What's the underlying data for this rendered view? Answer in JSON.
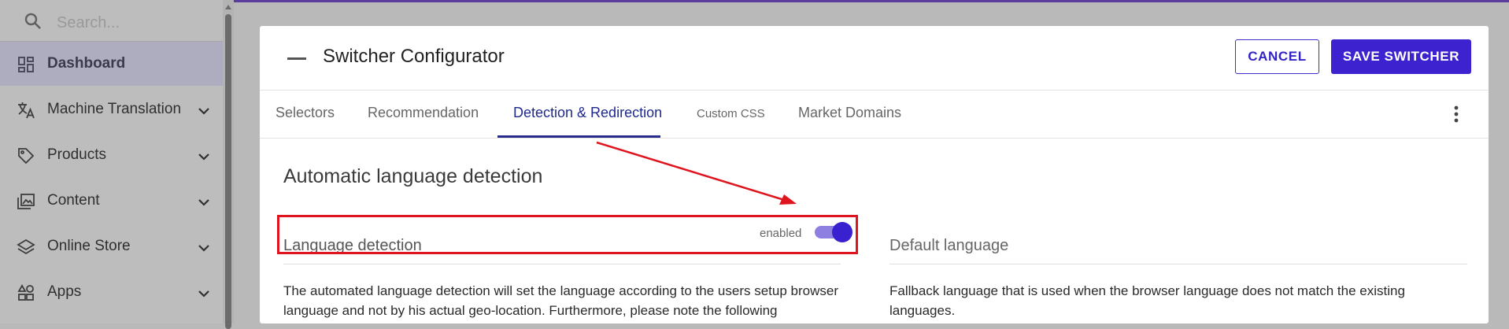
{
  "search": {
    "placeholder": "Search..."
  },
  "sidebar": {
    "items": [
      {
        "label": "Dashboard",
        "icon": "dashboard-icon",
        "active": true
      },
      {
        "label": "Machine Translation",
        "icon": "translate-icon",
        "expandable": true
      },
      {
        "label": "Products",
        "icon": "tag-icon",
        "expandable": true
      },
      {
        "label": "Content",
        "icon": "image-gallery-icon",
        "expandable": true
      },
      {
        "label": "Online Store",
        "icon": "layers-icon",
        "expandable": true
      },
      {
        "label": "Apps",
        "icon": "apps-icon",
        "expandable": true
      }
    ]
  },
  "dialog": {
    "title": "Switcher Configurator",
    "cancel_label": "CANCEL",
    "save_label": "SAVE SWITCHER"
  },
  "tabs": [
    {
      "label": "Selectors",
      "active": false
    },
    {
      "label": "Recommendation",
      "active": false
    },
    {
      "label": "Detection & Redirection",
      "active": true
    },
    {
      "label": "Custom CSS",
      "active": false
    },
    {
      "label": "Market Domains",
      "active": false
    }
  ],
  "section": {
    "title": "Automatic language detection",
    "language_detection": {
      "label": "Language detection",
      "status": "enabled",
      "toggle_on": true,
      "description": "The automated language detection will set the language according to the users setup browser language and not by his actual geo-location. Furthermore, please note the following"
    },
    "default_language": {
      "label": "Default language",
      "description": "Fallback language that is used when the browser language does not match the existing languages."
    }
  },
  "colors": {
    "accent": "#3d22cf",
    "tab_active": "#2a2c8c",
    "annotation": "#e0141e",
    "sidebar_bg": "#bdbdbd"
  }
}
